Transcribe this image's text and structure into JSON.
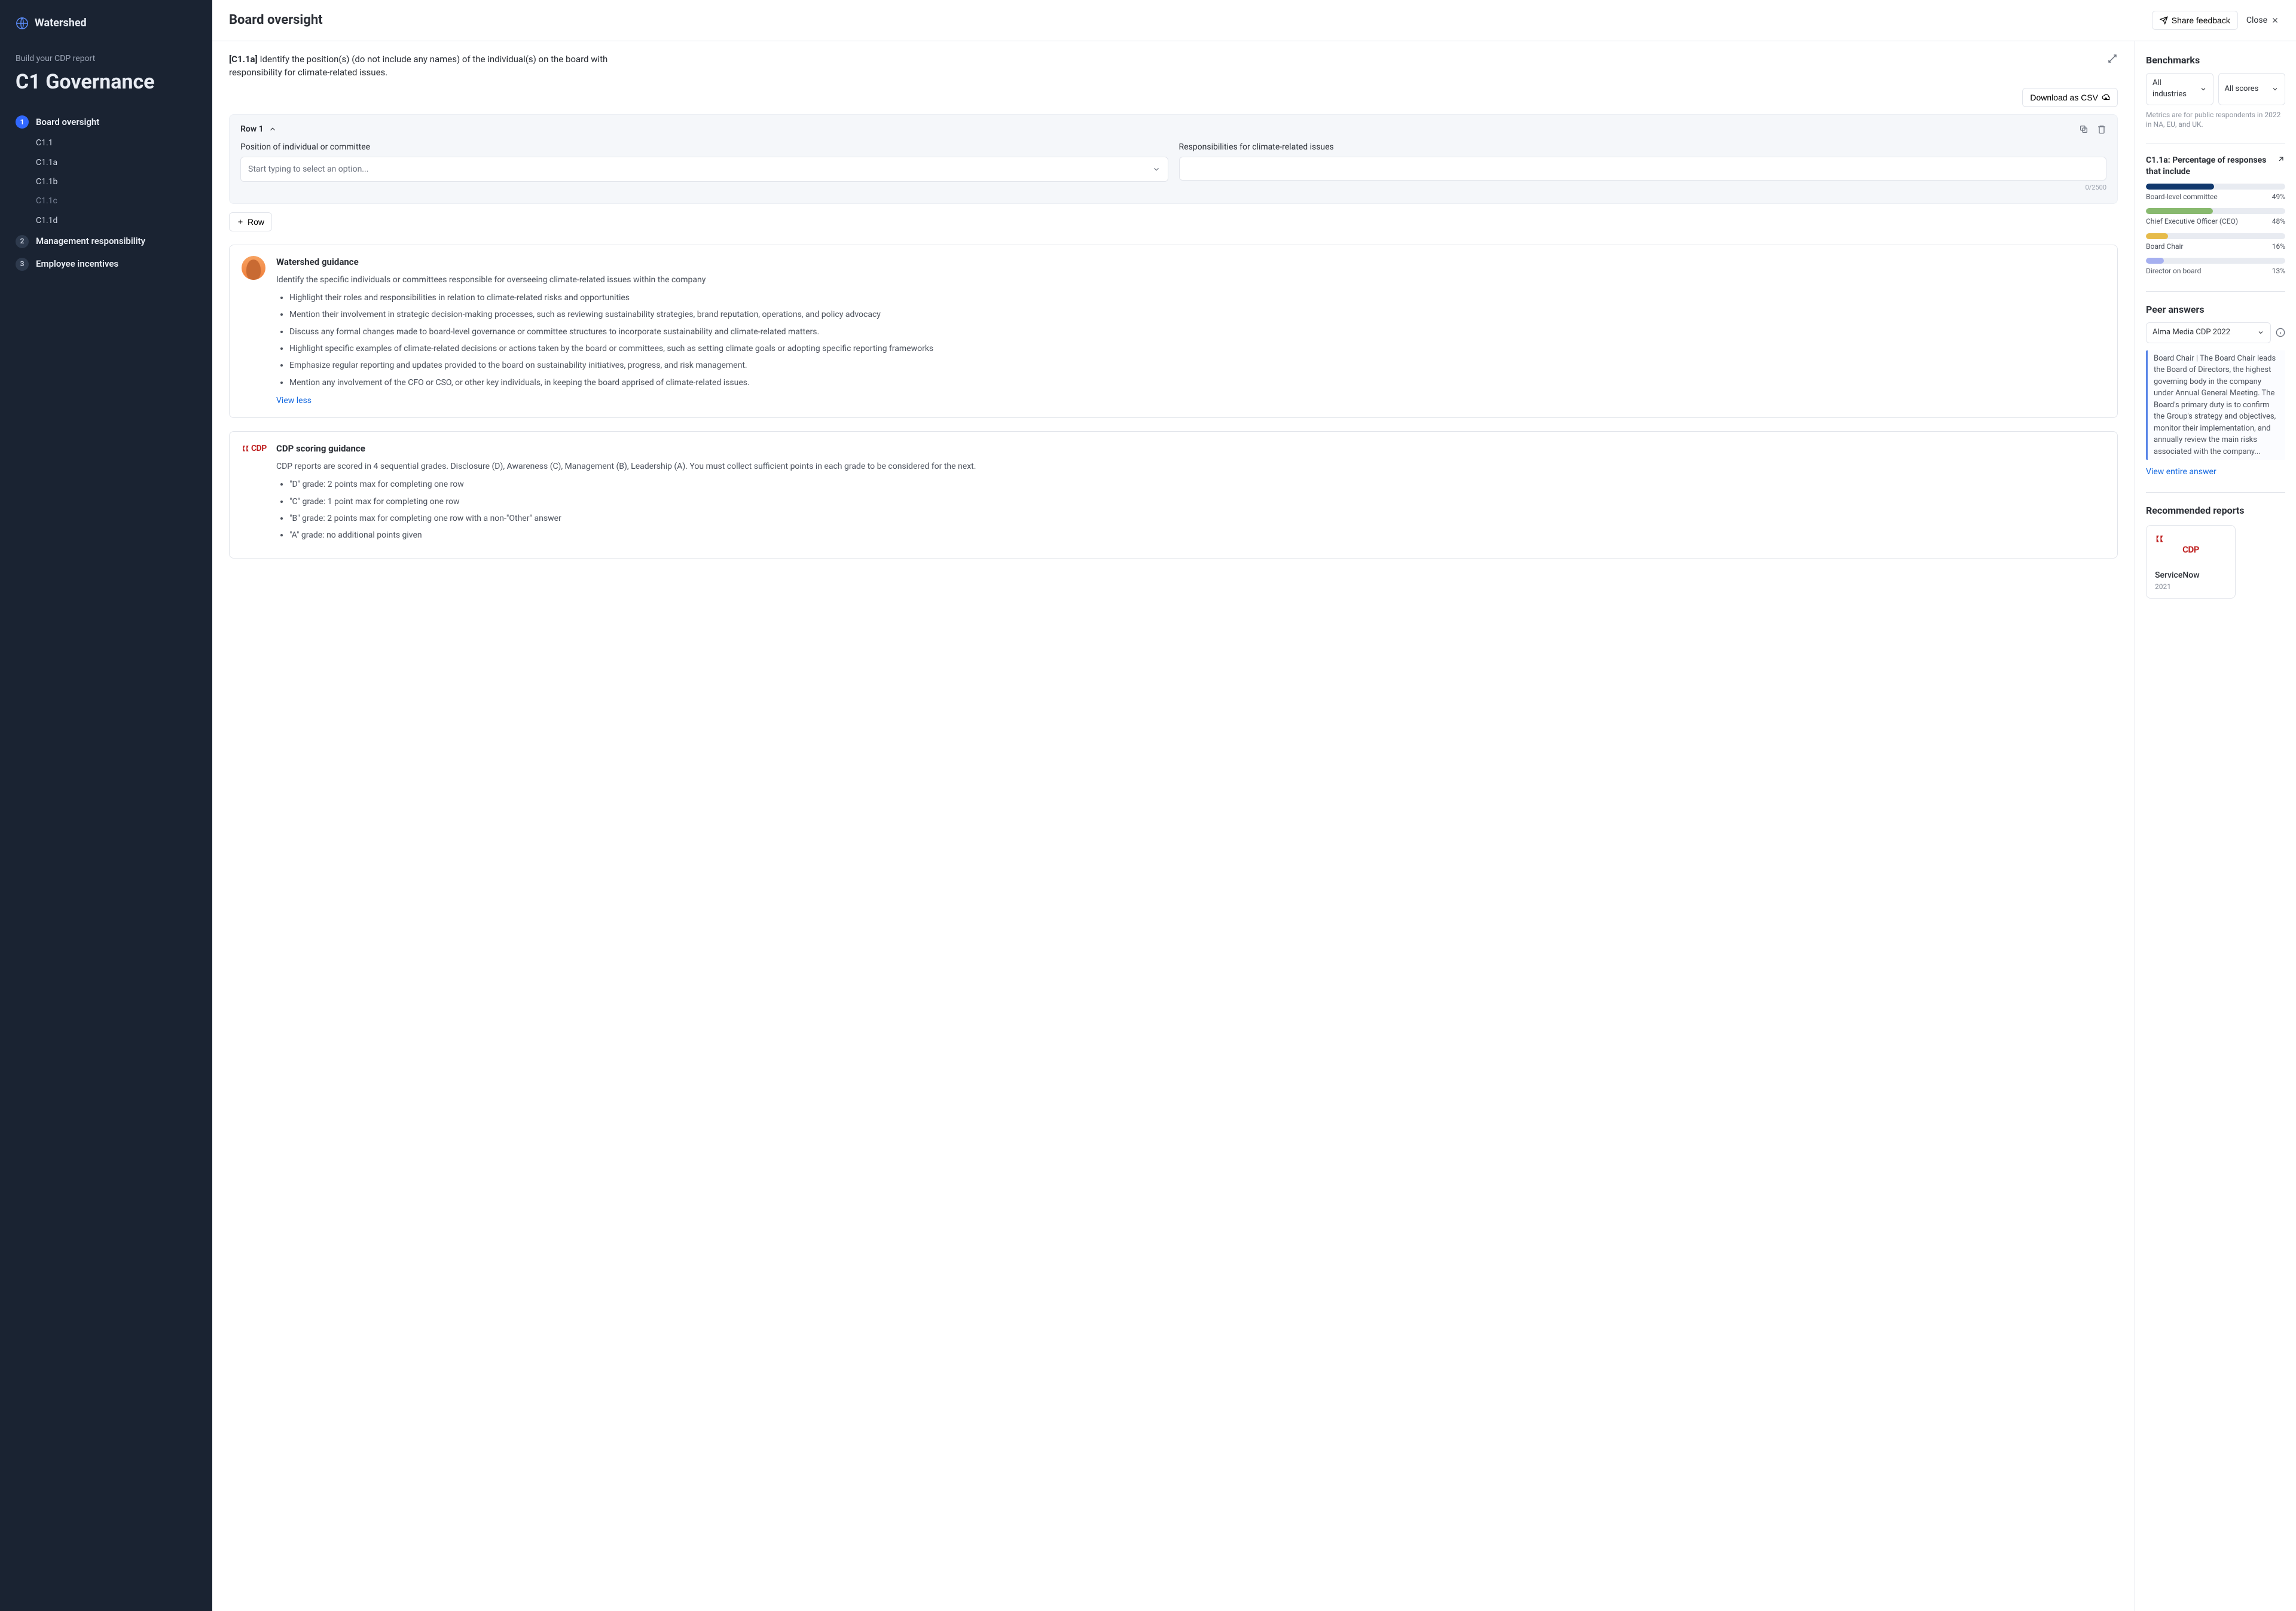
{
  "brand": "Watershed",
  "sidebar": {
    "subtitle": "Build your CDP report",
    "title": "C1 Governance",
    "sections": [
      {
        "num": "1",
        "label": "Board oversight",
        "active": true,
        "subs": [
          "C1.1",
          "C1.1a",
          "C1.1b",
          "C1.1c",
          "C1.1d"
        ]
      },
      {
        "num": "2",
        "label": "Management responsibility",
        "active": false
      },
      {
        "num": "3",
        "label": "Employee incentives",
        "active": false
      }
    ]
  },
  "header": {
    "title": "Board oversight",
    "share_label": "Share feedback",
    "close_label": "Close"
  },
  "question": {
    "id": "[C1.1a]",
    "text": "Identify the position(s) (do not include any names) of the individual(s) on the board with responsibility for climate-related issues."
  },
  "download_label": "Download as CSV",
  "row": {
    "title": "Row 1",
    "field1_label": "Position of individual or committee",
    "field1_placeholder": "Start typing to select an option...",
    "field2_label": "Responsibilities for climate-related issues",
    "counter": "0/2500"
  },
  "add_row_label": "Row",
  "guidance": {
    "title": "Watershed guidance",
    "intro": "Identify the specific individuals or committees responsible for overseeing climate-related issues within the company",
    "bullets": [
      "Highlight their roles and responsibilities in relation to climate-related risks and opportunities",
      "Mention their involvement in strategic decision-making processes, such as reviewing sustainability strategies, brand reputation, operations, and policy advocacy",
      "Discuss any formal changes made to board-level governance or committee structures to incorporate sustainability and climate-related matters.",
      "Highlight specific examples of climate-related decisions or actions taken by the board or committees, such as setting climate goals or adopting specific reporting frameworks",
      "Emphasize regular reporting and updates provided to the board on sustainability initiatives, progress, and risk management.",
      "Mention any involvement of the CFO or CSO, or other key individuals, in keeping the board apprised of climate-related issues."
    ],
    "toggle": "View less"
  },
  "cdp_brand": "CDP",
  "cdp_scoring": {
    "title": "CDP scoring guidance",
    "intro": "CDP reports are scored in 4 sequential grades. Disclosure (D), Awareness (C), Management (B), Leadership (A). You must collect sufficient points in each grade to be considered for the next.",
    "bullets": [
      "\"D\" grade: 2 points max for completing one row",
      "\"C\" grade: 1 point max for completing one row",
      "\"B\" grade: 2 points max for completing one row with a non-\"Other\" answer",
      "\"A\" grade: no additional points given"
    ]
  },
  "benchmarks": {
    "title": "Benchmarks",
    "filter1": "All industries",
    "filter2": "All scores",
    "note": "Metrics are for public respondents in 2022 in NA, EU, and UK."
  },
  "chart_data": {
    "type": "bar",
    "title": "C1.1a: Percentage of responses that include",
    "xlabel": "",
    "ylabel": "%",
    "ylim": [
      0,
      100
    ],
    "series": [
      {
        "name": "Board-level committee",
        "value": 49,
        "color": "#11386d"
      },
      {
        "name": "Chief Executive Officer (CEO)",
        "value": 48,
        "color": "#88b96e"
      },
      {
        "name": "Board Chair",
        "value": 16,
        "color": "#e6bb4a"
      },
      {
        "name": "Director on board",
        "value": 13,
        "color": "#a6b0f0"
      }
    ]
  },
  "peer": {
    "title": "Peer answers",
    "select": "Alma Media CDP 2022",
    "quote": "Board Chair | The Board Chair leads the Board of Directors, the highest governing body in the company under Annual General Meeting. The Board's primary duty is to confirm the Group's strategy and objectives, monitor their implementation, and annually review the main risks associated with the company...",
    "view": "View entire answer"
  },
  "recommended": {
    "title": "Recommended reports",
    "card_title": "ServiceNow",
    "card_year": "2021"
  }
}
